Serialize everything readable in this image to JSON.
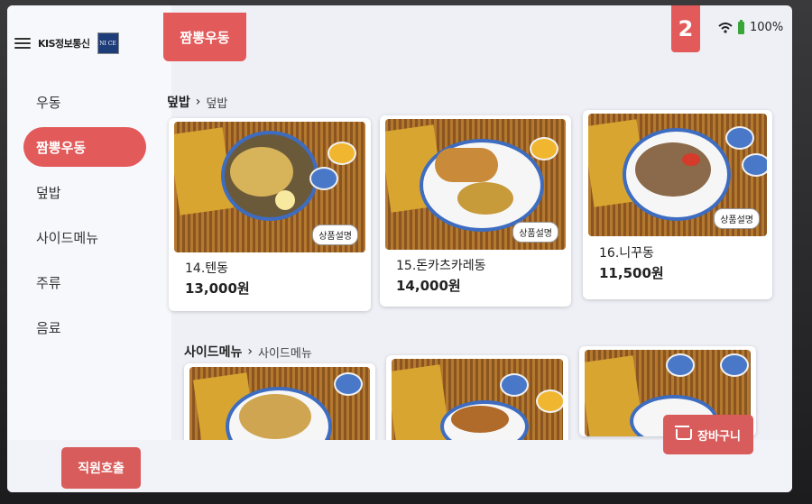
{
  "brand": {
    "name": "KIS정보통신",
    "logo_text": "NI CE"
  },
  "sidebar": {
    "items": [
      {
        "label": "우동",
        "active": false
      },
      {
        "label": "짬뽕우동",
        "active": true
      },
      {
        "label": "덮밥",
        "active": false
      },
      {
        "label": "사이드메뉴",
        "active": false
      },
      {
        "label": "주류",
        "active": false
      },
      {
        "label": "음료",
        "active": false
      }
    ]
  },
  "header": {
    "category_tab": "짬뽕우동",
    "cart_count": "2",
    "battery": "100%"
  },
  "sections": [
    {
      "title": "덮밥",
      "subtitle": "덮밥"
    },
    {
      "title": "사이드메뉴",
      "subtitle": "사이드메뉴"
    }
  ],
  "products": [
    {
      "name": "14.텐동",
      "price": "13,000원",
      "badge": "상품설명"
    },
    {
      "name": "15.돈카츠카레동",
      "price": "14,000원",
      "badge": "상품설명"
    },
    {
      "name": "16.니꾸동",
      "price": "11,500원",
      "badge": "상품설명"
    }
  ],
  "footer": {
    "staff_call": "직원호출",
    "cart": "장바구니"
  },
  "colors": {
    "accent": "#e25a5a",
    "background": "#eef0f6"
  }
}
